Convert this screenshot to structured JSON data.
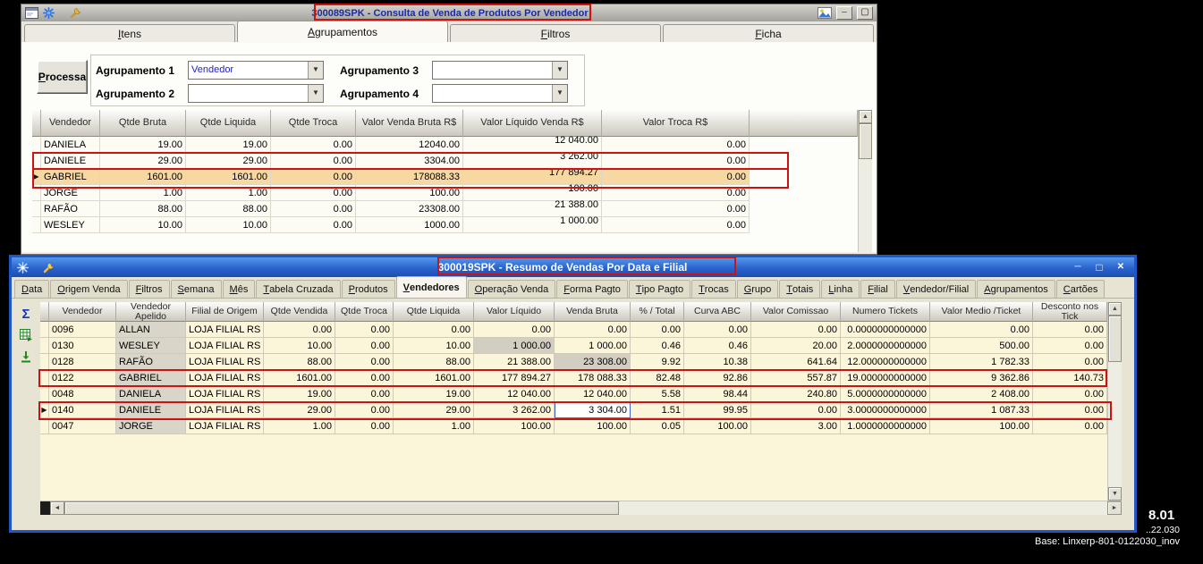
{
  "win1": {
    "title": "300089SPK - Consulta de Venda de Produtos Por Vendedor",
    "tabs": [
      {
        "label": "Itens",
        "active": false
      },
      {
        "label": "Agrupamentos",
        "active": true
      },
      {
        "label": "Filtros",
        "active": false
      },
      {
        "label": "Ficha",
        "active": false
      }
    ],
    "processa": "Processa",
    "groupings": [
      {
        "label": "Agrupamento 1",
        "value": "Vendedor"
      },
      {
        "label": "Agrupamento 2",
        "value": ""
      },
      {
        "label": "Agrupamento 3",
        "value": ""
      },
      {
        "label": "Agrupamento 4",
        "value": ""
      }
    ],
    "grid": {
      "columns": [
        "Vendedor",
        "Qtde Bruta",
        "Qtde Liquida",
        "Qtde Troca",
        "Valor Venda Bruta R$",
        "Valor Líquido Venda R$",
        "Valor Troca R$"
      ],
      "rows": [
        {
          "cells": [
            "DANIELA",
            "19.00",
            "19.00",
            "0.00",
            "12040.00",
            "12 040.00",
            "0.00"
          ]
        },
        {
          "cells": [
            "DANIELE",
            "29.00",
            "29.00",
            "0.00",
            "3304.00",
            "3 262.00",
            "0.00"
          ]
        },
        {
          "cells": [
            "GABRIEL",
            "1601.00",
            "1601.00",
            "0.00",
            "178088.33",
            "177 894.27",
            "0.00"
          ],
          "highlight": true,
          "pointer": true
        },
        {
          "cells": [
            "JORGE",
            "1.00",
            "1.00",
            "0.00",
            "100.00",
            "100.00",
            "0.00"
          ]
        },
        {
          "cells": [
            "RAFÃO",
            "88.00",
            "88.00",
            "0.00",
            "23308.00",
            "21 388.00",
            "0.00"
          ]
        },
        {
          "cells": [
            "WESLEY",
            "10.00",
            "10.00",
            "0.00",
            "1000.00",
            "1 000.00",
            "0.00"
          ]
        }
      ]
    },
    "titlebar_icons": [
      "form-icon",
      "snowflake-icon",
      "wrench-icon"
    ],
    "titlebar_buttons": [
      "picture-icon",
      "minimize-icon",
      "maximize-icon"
    ]
  },
  "win2": {
    "title": "300019SPK - Resumo de Vendas Por Data e Filial",
    "tabs": [
      "Data",
      "Origem Venda",
      "Filtros",
      "Semana",
      "Mês",
      "Tabela Cruzada",
      "Produtos",
      "Vendedores",
      "Operação Venda",
      "Forma Pagto",
      "Tipo Pagto",
      "Trocas",
      "Grupo",
      "Totais",
      "Linha",
      "Filial",
      "Vendedor/Filial",
      "Agrupamentos",
      "Cartões"
    ],
    "active_tab": "Vendedores",
    "titlebar_icons": [
      "snowflake-icon",
      "wrench-icon"
    ],
    "titlebar_buttons": [
      "minimize-icon",
      "maximize-icon",
      "close-icon"
    ],
    "side_toolbar_icons": [
      "sum-sigma-icon",
      "export-grid-icon",
      "export-download-icon"
    ],
    "grid": {
      "columns": [
        "Vendedor",
        "Vendedor Apelido",
        "Filial de Origem",
        "Qtde Vendida",
        "Qtde Troca",
        "Qtde Liquida",
        "Valor Líquido",
        "Venda Bruta",
        "% / Total",
        "Curva ABC",
        "Valor Comissao",
        "Numero Tickets",
        "Valor Medio /Ticket",
        "Desconto nos Tick"
      ],
      "rows": [
        {
          "cells": [
            "0096",
            "ALLAN",
            "LOJA FILIAL RS",
            "0.00",
            "0.00",
            "0.00",
            "0.00",
            "0.00",
            "0.00",
            "0.00",
            "0.00",
            "0.0000000000000",
            "0.00",
            "0.00"
          ]
        },
        {
          "cells": [
            "0130",
            "WESLEY",
            "LOJA FILIAL RS",
            "10.00",
            "0.00",
            "10.00",
            "1 000.00",
            "1 000.00",
            "0.46",
            "0.46",
            "20.00",
            "2.0000000000000",
            "500.00",
            "0.00"
          ],
          "gray_cells": [
            6
          ]
        },
        {
          "cells": [
            "0128",
            "RAFÃO",
            "LOJA FILIAL RS",
            "88.00",
            "0.00",
            "88.00",
            "21 388.00",
            "23 308.00",
            "9.92",
            "10.38",
            "641.64",
            "12.000000000000",
            "1 782.33",
            "0.00"
          ],
          "gray_cells": [
            7
          ]
        },
        {
          "cells": [
            "0122",
            "GABRIEL",
            "LOJA FILIAL RS",
            "1601.00",
            "0.00",
            "1601.00",
            "177 894.27",
            "178 088.33",
            "82.48",
            "92.86",
            "557.87",
            "19.000000000000",
            "9 362.86",
            "140.73"
          ]
        },
        {
          "cells": [
            "0048",
            "DANIELA",
            "LOJA FILIAL RS",
            "19.00",
            "0.00",
            "19.00",
            "12 040.00",
            "12 040.00",
            "5.58",
            "98.44",
            "240.80",
            "5.0000000000000",
            "2 408.00",
            "0.00"
          ]
        },
        {
          "cells": [
            "0140",
            "DANIELE",
            "LOJA FILIAL RS",
            "29.00",
            "0.00",
            "29.00",
            "3 262.00",
            "3 304.00",
            "1.51",
            "99.95",
            "0.00",
            "3.0000000000000",
            "1 087.33",
            "0.00"
          ],
          "pointer": true,
          "selected_cell": 7
        },
        {
          "cells": [
            "0047",
            "JORGE",
            "LOJA FILIAL RS",
            "1.00",
            "0.00",
            "1.00",
            "100.00",
            "100.00",
            "0.05",
            "100.00",
            "3.00",
            "1.0000000000000",
            "100.00",
            "0.00"
          ]
        }
      ]
    }
  },
  "footer": {
    "version": "8.01",
    "build": "..22.030",
    "base": "Base: Linxerp-801-0122030_inov"
  }
}
